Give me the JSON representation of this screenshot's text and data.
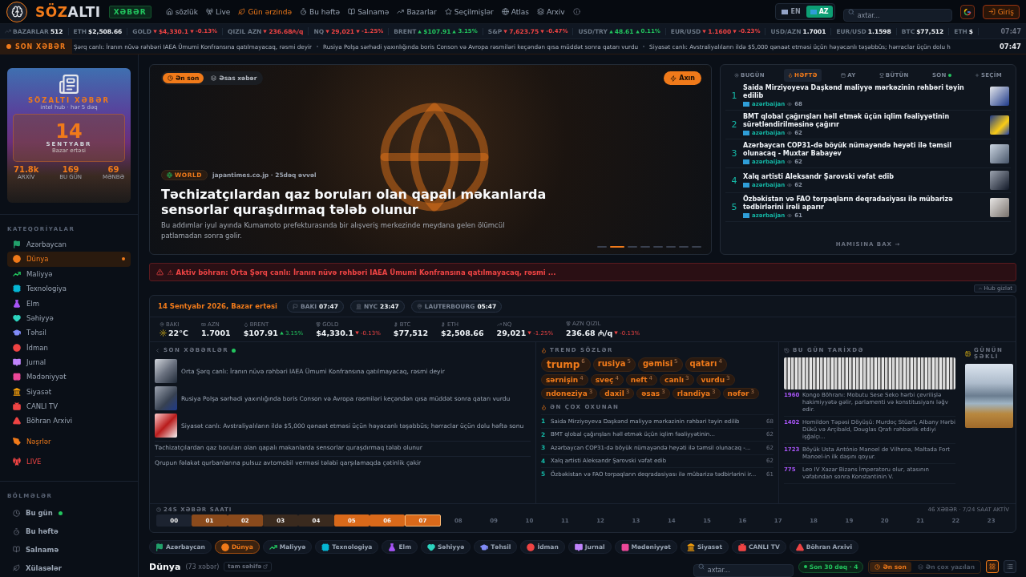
{
  "header": {
    "logo": {
      "accent": "SÖZ",
      "rest": "ALTI"
    },
    "badge": "XƏBƏR",
    "nav": [
      {
        "label": "sözlük",
        "selected": false
      },
      {
        "label": "Live",
        "selected": false
      },
      {
        "label": "Gün ərzində",
        "selected": true
      },
      {
        "label": "Bu həftə",
        "selected": false
      },
      {
        "label": "Salnamə",
        "selected": false
      },
      {
        "label": "Bazarlar",
        "selected": false
      },
      {
        "label": "Seçilmişlər",
        "selected": false
      },
      {
        "label": "Atlas",
        "selected": false
      },
      {
        "label": "Arxiv",
        "selected": false
      }
    ],
    "languages": [
      {
        "label": "EN",
        "selected": false
      },
      {
        "label": "AZ",
        "selected": true
      }
    ],
    "search": {
      "placeholder": "axtar..."
    },
    "login": "Giriş"
  },
  "market_ticker": {
    "items": [
      {
        "label": "BAZARLAR",
        "value": "512"
      },
      {
        "label": "ETH",
        "value": "$2,508.66"
      },
      {
        "label": "GOLD",
        "value": "$4,330.1",
        "change": "-0.13%",
        "rising": false
      },
      {
        "label": "QIZIL AZN",
        "value": "236.68₼/q",
        "rising": false
      },
      {
        "label": "NQ",
        "value": "29,021",
        "change": "-1.25%",
        "rising": false
      },
      {
        "label": "BRENT",
        "value": "$107.91",
        "change": "3.15%",
        "rising": true
      },
      {
        "label": "S&P",
        "value": "7,623.75",
        "change": "-0.47%",
        "rising": false
      },
      {
        "label": "USD/TRY",
        "value": "48.61",
        "change": "0.11%",
        "rising": true
      },
      {
        "label": "EUR/USD",
        "value": "1.1600",
        "change": "-0.23%",
        "rising": false
      },
      {
        "label": "USD/AZN",
        "value": "1.7001"
      },
      {
        "label": "EUR/USD",
        "value": "1.1598"
      },
      {
        "label": "BTC",
        "value": "$77,512"
      },
      {
        "label": "ETH",
        "value": "$"
      }
    ],
    "time": "07:47"
  },
  "news_ticker": {
    "label": "SON XƏBƏR",
    "items": [
      "Şərq canlı: İranın nüvə rəhbəri IAEA Ümumi Konfransına qatılmayacaq, rəsmi deyir",
      "Rusiya Polşa sərhədi yaxınlığında boris Conson və Avropa rəsmiləri keçəndən qısa müddət sonra qatarı vurdu",
      "Siyasət canlı: Avstraliyalıların ildə $5,000 qənaət etməsi üçün həyəcanlı təşəbbüs; hərraclar üçün dolu h"
    ],
    "time": "07:47"
  },
  "sidebar": {
    "hub": {
      "title": "SÖZALTI XƏBƏR",
      "subtitle": "intel hub · hər 5 dəq",
      "day": "14",
      "month": "SENTYABR",
      "weekday": "Bazar ertəsi",
      "stats": [
        {
          "value": "71.8k",
          "label": "ARXİV"
        },
        {
          "value": "169",
          "label": "BU GÜN"
        },
        {
          "value": "69",
          "label": "MƏNBƏ"
        }
      ]
    },
    "categories_title": "KATEQORİYALAR",
    "categories": [
      {
        "label": "Azərbaycan",
        "color": "#22a06b",
        "selected": false
      },
      {
        "label": "Dünya",
        "color": "#f07a1a",
        "selected": true
      },
      {
        "label": "Maliyyə",
        "color": "#22c55e",
        "selected": false
      },
      {
        "label": "Texnologiya",
        "color": "#06b6d4",
        "selected": false
      },
      {
        "label": "Elm",
        "color": "#a855f7",
        "selected": false
      },
      {
        "label": "Səhiyyə",
        "color": "#2dd4bf",
        "selected": false
      },
      {
        "label": "Təhsil",
        "color": "#818cf8",
        "selected": false
      },
      {
        "label": "İdman",
        "color": "#ef4444",
        "selected": false
      },
      {
        "label": "Jurnal",
        "color": "#c084fc",
        "selected": false
      },
      {
        "label": "Mədəniyyət",
        "color": "#ec4899",
        "selected": false
      },
      {
        "label": "Siyasət",
        "color": "#f59e0b",
        "selected": false
      },
      {
        "label": "CANLI TV",
        "color": "#ef4444",
        "selected": false
      },
      {
        "label": "Böhran Arxivi",
        "color": "#ef4444",
        "selected": false
      }
    ],
    "extra_links": [
      {
        "label": "Nəşrlər",
        "color": "#f07a1a"
      },
      {
        "label": "LIVE",
        "color": "#ef4444"
      }
    ],
    "sections_title": "BÖLMƏLƏR",
    "sections": [
      {
        "label": "Bu gün",
        "live": true
      },
      {
        "label": "Bu həftə",
        "live": false
      },
      {
        "label": "Salnamə",
        "live": false
      },
      {
        "label": "Xülasələr",
        "live": false
      }
    ]
  },
  "hero": {
    "modes": [
      {
        "label": "Ən son",
        "selected": true
      },
      {
        "label": "Əsas xəbər",
        "selected": false
      }
    ],
    "stream_button": "Axın",
    "tag": "WORLD",
    "source": "japantimes.co.jp · 25dəq əvvəl",
    "title": "Təchizatçılardan qaz boruları olan qapalı məkanlarda sensorlar quraşdırmaq tələb olunur",
    "description": "Bu addımlar iyul ayında Kumamoto prefekturasında bir alışveriş merkezinde meydana gelen ölümcül patlamadan sonra gəlir.",
    "slides": [
      {
        "selected": false
      },
      {
        "selected": true
      },
      {
        "selected": false
      },
      {
        "selected": false
      },
      {
        "selected": false
      },
      {
        "selected": false
      },
      {
        "selected": false
      },
      {
        "selected": false
      }
    ]
  },
  "top_panel": {
    "tabs": [
      {
        "label": "BUGÜN",
        "selected": false,
        "live": false
      },
      {
        "label": "HƏFTƏ",
        "selected": true,
        "live": false
      },
      {
        "label": "AY",
        "selected": false,
        "live": false
      },
      {
        "label": "BÜTÜN",
        "selected": false,
        "live": false
      },
      {
        "label": "SON",
        "selected": false,
        "live": true
      },
      {
        "label": "SEÇİM",
        "selected": false,
        "live": false
      }
    ],
    "items": [
      {
        "rank": "1",
        "title": "Saida Mirziyoyeva Daşkənd maliyyə mərkəzinin rəhbəri təyin edilib",
        "source": "azərbaijan",
        "views": "68"
      },
      {
        "rank": "2",
        "title": "BMT qlobal çağırışları həll etmək üçün iqlim fəaliyyətinin sürətləndirilməsinə çağırır",
        "source": "azərbaijan",
        "views": "62"
      },
      {
        "rank": "3",
        "title": "Azərbaycan COP31-də böyük nümayəndə heyəti ilə təmsil olunacaq - Muxtar Babayev",
        "source": "azərbaijan",
        "views": "62"
      },
      {
        "rank": "4",
        "title": "Xalq artisti Aleksandr Şarovski vəfat edib",
        "source": "azərbaijan",
        "views": "62"
      },
      {
        "rank": "5",
        "title": "Özbəkistan və FAO torpaqların deqradasiyası ilə mübarizə tədbirlərini irəli aparır",
        "source": "azərbaijan",
        "views": "61"
      }
    ],
    "more": "HAMISINA BAX →"
  },
  "alert": "⚠ Aktiv böhran: Orta Şərq canlı: İranın nüvə rəhbəri IAEA Ümumi Konfransına qatılmayacaq, rəsmi ...",
  "hide_hub": "Hub gizlət",
  "dashboard": {
    "date": "14 Sentyabr 2026, Bazar ertəsi",
    "clocks": [
      {
        "city": "BAKI",
        "time": "07:47"
      },
      {
        "city": "NYC",
        "time": "23:47"
      },
      {
        "city": "LAUTERBOURG",
        "time": "05:47"
      }
    ],
    "stats": [
      {
        "kind": "weather",
        "label": "BAKI",
        "value": "22°C"
      },
      {
        "kind": "money",
        "label": "AZN",
        "value": "1.7001"
      },
      {
        "kind": "oil",
        "label": "BRENT",
        "value": "$107.91",
        "change": "3.15%",
        "rising": true
      },
      {
        "kind": "gold",
        "label": "GOLD",
        "value": "$4,330.1",
        "change": "-0.13%",
        "rising": false
      },
      {
        "kind": "crypto",
        "label": "BTC",
        "value": "$77,512"
      },
      {
        "kind": "crypto",
        "label": "ETH",
        "value": "$2,508.66"
      },
      {
        "kind": "index",
        "label": "NQ",
        "value": "29,021",
        "change": "-1.25%",
        "rising": false
      },
      {
        "kind": "gold",
        "label": "AZN QIZIL",
        "value": "236.68 ₼/q",
        "change": "-0.13%",
        "rising": false
      }
    ],
    "latest": {
      "title": "SON XƏBƏRLƏR",
      "live": true,
      "items": [
        {
          "title": "Orta Şərq canlı: İranın nüvə rəhbəri IAEA Ümumi Konfransına qatılmayacaq, rəsmi deyir",
          "kind": "photo"
        },
        {
          "title": "Rusiya Polşa sərhədi yaxınlığında boris Conson və Avropa rəsmiləri keçəndən qısa müddət sonra qatarı vurdu",
          "kind": "photo"
        },
        {
          "title": "Siyasət canlı: Avstraliyalıların ildə $5,000 qənaət etməsi üçün həyəcanlı təşəbbüs; hərraclar üçün dolu həftə sonu",
          "kind": "photo"
        },
        {
          "title": "Təchizatçılardan qaz boruları olan qapalı məkanlarda sensorlar quraşdırmaq tələb olunur",
          "kind": "text"
        },
        {
          "title": "Qrupun fəlakət qurbanlarına pulsuz avtomobil verməsi tələbi qarşılamaqda çətinlik çəkir",
          "kind": "text"
        }
      ]
    },
    "trends": {
      "title": "TREND SÖZLƏR",
      "words": [
        {
          "word": "trump",
          "count": "6",
          "kind": "hot"
        },
        {
          "word": "rusiya",
          "count": "5",
          "kind": "warm"
        },
        {
          "word": "gəmisi",
          "count": "5",
          "kind": "warm"
        },
        {
          "word": "qatarı",
          "count": "4",
          "kind": "warm"
        },
        {
          "word": "sərnişin",
          "count": "4",
          "kind": "normal"
        },
        {
          "word": "sveç",
          "count": "4",
          "kind": "normal"
        },
        {
          "word": "neft",
          "count": "4",
          "kind": "normal"
        },
        {
          "word": "canlı",
          "count": "3",
          "kind": "normal"
        },
        {
          "word": "vurdu",
          "count": "3",
          "kind": "normal"
        },
        {
          "word": "ndoneziya",
          "count": "3",
          "kind": "normal"
        },
        {
          "word": "daxil",
          "count": "3",
          "kind": "normal"
        },
        {
          "word": "əsas",
          "count": "3",
          "kind": "normal"
        },
        {
          "word": "rlandiya",
          "count": "3",
          "kind": "normal"
        },
        {
          "word": "nəfər",
          "count": "3",
          "kind": "normal"
        }
      ]
    },
    "most_read": {
      "title": "ƏN ÇOX OXUNAN",
      "items": [
        {
          "rank": "1",
          "title": "Saida Mirziyoyeva Daşkənd maliyyə mərkəzinin rəhbəri təyin edilib",
          "views": "68"
        },
        {
          "rank": "2",
          "title": "BMT qlobal çağırışları həll etmək üçün iqlim fəaliyyətinin...",
          "views": "62"
        },
        {
          "rank": "3",
          "title": "Azərbaycan COP31-də böyük nümayəndə heyəti ilə təmsil olunacaq -...",
          "views": "62"
        },
        {
          "rank": "4",
          "title": "Xalq artisti Aleksandr Şarovski vəfat edib",
          "views": "62"
        },
        {
          "rank": "5",
          "title": "Özbəkistan və FAO torpaqların deqradasiyası ilə mübarizə tədbirlərini ir...",
          "views": "61"
        }
      ]
    },
    "history": {
      "title": "BU GÜN TARİXDƏ",
      "events": [
        {
          "year": "1960",
          "text": "Kongo Böhranı: Mobutu Sese Seko hərbi çevrilişlə hakimiyyətə gəlir, parlamenti və konstitusiyanı ləğv edir."
        },
        {
          "year": "1402",
          "text": "Homildon Təpəsi Döyüşü: Murdoç Stüart, Albany Hərbi Dükü və Arçibald, Douglas Qrafı rəhbərlik etdiyi işğalçı..."
        },
        {
          "year": "1723",
          "text": "Böyük Usta António Manoel de Vilhena, Maltada Fort Manoel-in ilk daşını qoyur."
        },
        {
          "year": "775",
          "text": "Leo IV Xazar Bizans İmperatoru olur, atasının vəfatından sonra Konstantinin V."
        }
      ]
    },
    "photo_of_day": {
      "title": "GÜNÜN ŞƏKLİ"
    },
    "hours": {
      "title": "24S XƏBƏR SAATI",
      "summary": "46 XƏBƏR · 7/24 SAAT AKTİV",
      "items": [
        {
          "label": "00",
          "kind": "empty",
          "selected": false
        },
        {
          "label": "01",
          "kind": "medium",
          "selected": false
        },
        {
          "label": "02",
          "kind": "medium",
          "selected": false
        },
        {
          "label": "03",
          "kind": "low",
          "selected": false
        },
        {
          "label": "04",
          "kind": "low",
          "selected": false
        },
        {
          "label": "05",
          "kind": "high",
          "selected": false
        },
        {
          "label": "06",
          "kind": "high",
          "selected": false
        },
        {
          "label": "07",
          "kind": "high",
          "selected": true
        },
        {
          "label": "08",
          "kind": "future",
          "selected": false
        },
        {
          "label": "09",
          "kind": "future",
          "selected": false
        },
        {
          "label": "10",
          "kind": "future",
          "selected": false
        },
        {
          "label": "11",
          "kind": "future",
          "selected": false
        },
        {
          "label": "12",
          "kind": "future",
          "selected": false
        },
        {
          "label": "13",
          "kind": "future",
          "selected": false
        },
        {
          "label": "14",
          "kind": "future",
          "selected": false
        },
        {
          "label": "15",
          "kind": "future",
          "selected": false
        },
        {
          "label": "16",
          "kind": "future",
          "selected": false
        },
        {
          "label": "17",
          "kind": "future",
          "selected": false
        },
        {
          "label": "18",
          "kind": "future",
          "selected": false
        },
        {
          "label": "19",
          "kind": "future",
          "selected": false
        },
        {
          "label": "20",
          "kind": "future",
          "selected": false
        },
        {
          "label": "21",
          "kind": "future",
          "selected": false
        },
        {
          "label": "22",
          "kind": "future",
          "selected": false
        },
        {
          "label": "23",
          "kind": "future",
          "selected": false
        }
      ]
    }
  },
  "category_chips": [
    {
      "label": "Azərbaycan",
      "color": "#22a06b",
      "selected": false
    },
    {
      "label": "Dünya",
      "color": "#f07a1a",
      "selected": true
    },
    {
      "label": "Maliyyə",
      "color": "#22c55e",
      "selected": false
    },
    {
      "label": "Texnologiya",
      "color": "#06b6d4",
      "selected": false
    },
    {
      "label": "Elm",
      "color": "#a855f7",
      "selected": false
    },
    {
      "label": "Səhiyyə",
      "color": "#2dd4bf",
      "selected": false
    },
    {
      "label": "Təhsil",
      "color": "#818cf8",
      "selected": false
    },
    {
      "label": "İdman",
      "color": "#ef4444",
      "selected": false
    },
    {
      "label": "Jurnal",
      "color": "#c084fc",
      "selected": false
    },
    {
      "label": "Mədəniyyət",
      "color": "#ec4899",
      "selected": false
    },
    {
      "label": "Siyasət",
      "color": "#f59e0b",
      "selected": false
    },
    {
      "label": "CANLI TV",
      "color": "#ef4444",
      "selected": false
    },
    {
      "label": "Böhran Arxivi",
      "color": "#ef4444",
      "selected": false
    }
  ],
  "feed_bar": {
    "title": "Dünya",
    "count": "(73 xəbər)",
    "full_page": "tam səhifə",
    "search": {
      "placeholder": "axtar..."
    },
    "recent": "Son 30 dəq · 4",
    "sorts": [
      {
        "label": "Ən son",
        "selected": true
      },
      {
        "label": "Ən çox yazılan",
        "selected": false
      }
    ],
    "views": [
      {
        "kind": "grid",
        "selected": true
      },
      {
        "kind": "list",
        "selected": false
      }
    ]
  }
}
